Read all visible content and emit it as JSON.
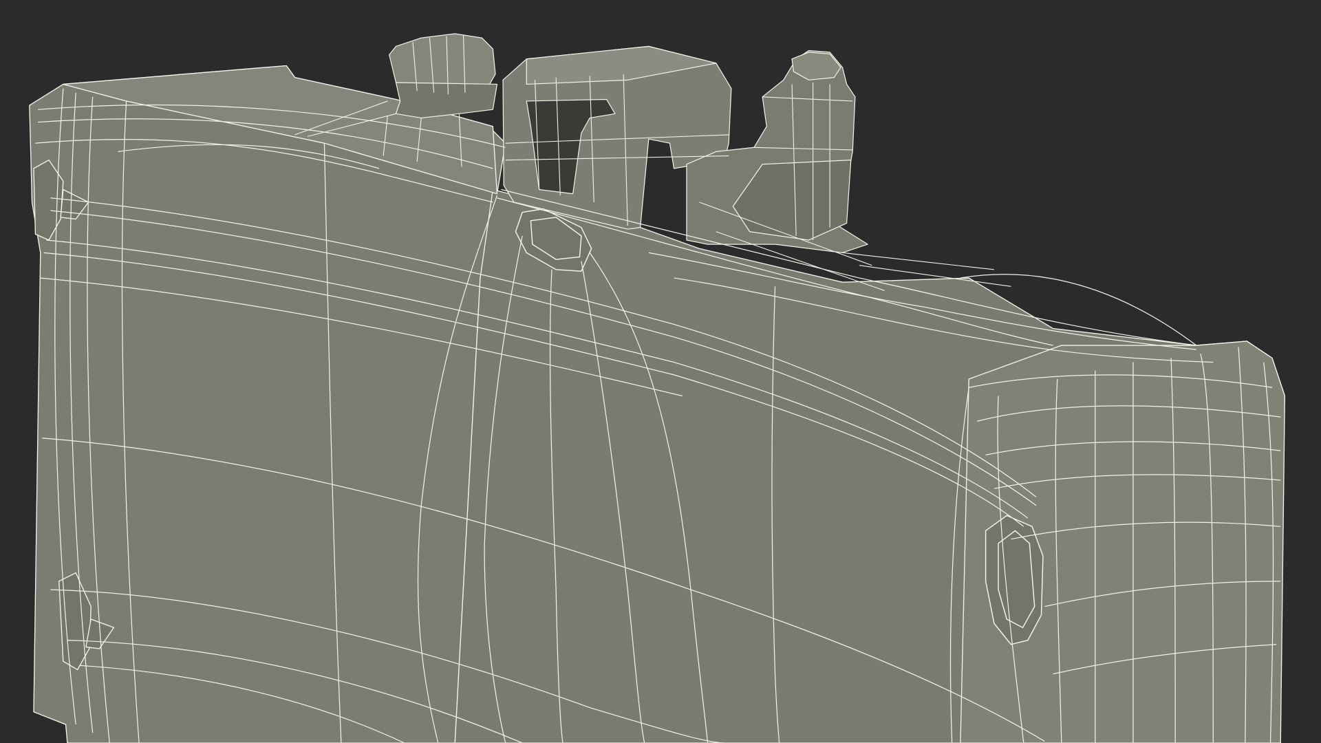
{
  "scene": {
    "subject": "jerrycan-wireframe-render",
    "colors": {
      "background": "#2b2b2b",
      "surface": "#7c7d72",
      "surface_dark": "#6a6b61",
      "surface_light": "#8a8b80",
      "wire": "#f2f2ea"
    }
  }
}
